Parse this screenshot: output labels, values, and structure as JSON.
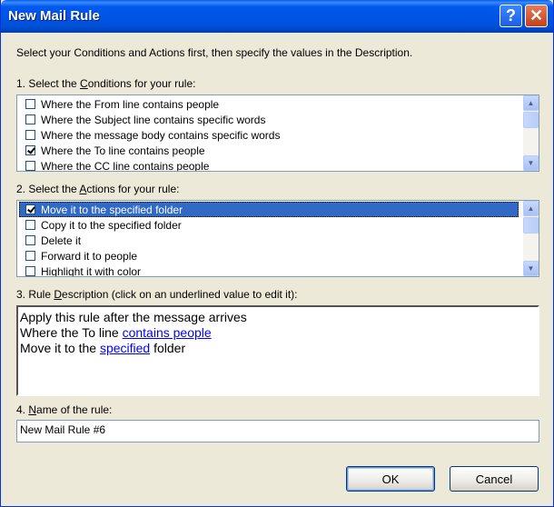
{
  "window": {
    "title": "New Mail Rule",
    "help_label": "?",
    "close_label": "✕"
  },
  "intro": "Select your Conditions and Actions first, then specify the values in the Description.",
  "conditions": {
    "label_prefix": "1. Select the ",
    "label_underlined": "C",
    "label_suffix": "onditions for your rule:",
    "items": [
      {
        "label": "Where the From line contains people",
        "checked": false
      },
      {
        "label": "Where the Subject line contains specific words",
        "checked": false
      },
      {
        "label": "Where the message body contains specific words",
        "checked": false
      },
      {
        "label": "Where the To line contains people",
        "checked": true
      },
      {
        "label": "Where the CC line contains people",
        "checked": false
      }
    ]
  },
  "actions": {
    "label_prefix": "2. Select the ",
    "label_underlined": "A",
    "label_suffix": "ctions for your rule:",
    "items": [
      {
        "label": "Move it to the specified folder",
        "checked": true,
        "selected": true
      },
      {
        "label": "Copy it to the specified folder",
        "checked": false
      },
      {
        "label": "Delete it",
        "checked": false
      },
      {
        "label": "Forward it to people",
        "checked": false
      },
      {
        "label": "Highlight it with color",
        "checked": false
      }
    ]
  },
  "description": {
    "label_prefix": "3. Rule ",
    "label_underlined": "D",
    "label_suffix": "escription (click on an underlined value to edit it):",
    "line1": "Apply this rule after the message arrives",
    "line2_text": "Where the To line ",
    "line2_link": "contains people",
    "line3_text": "Move it to the ",
    "line3_link": "specified",
    "line3_suffix": " folder"
  },
  "name": {
    "label_prefix": "4. ",
    "label_underlined": "N",
    "label_suffix": "ame of the rule:",
    "value": "New Mail Rule #6"
  },
  "buttons": {
    "ok": "OK",
    "cancel": "Cancel"
  },
  "icons": {
    "scroll_up": "▲",
    "scroll_down": "▼"
  },
  "colors": {
    "title_bar": "#0055E5",
    "selection": "#316AC5",
    "link": "#0000FF",
    "dialog_bg": "#ECE9D8"
  }
}
